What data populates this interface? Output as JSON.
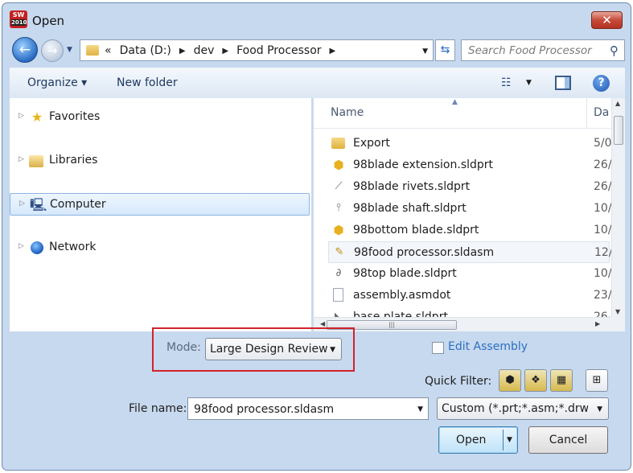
{
  "window": {
    "title": "Open",
    "app_icon_text": "SW",
    "app_icon_year": "2010",
    "close_glyph": "✕"
  },
  "nav": {
    "back_glyph": "←",
    "forward_glyph": "→",
    "breadcrumb_prefix": "«",
    "breadcrumbs": [
      "Data (D:)",
      "dev",
      "Food Processor"
    ],
    "search_placeholder": "Search Food Processor"
  },
  "toolbar": {
    "organize_label": "Organize ▾",
    "new_folder_label": "New folder",
    "help_glyph": "?"
  },
  "nav_pane": {
    "items": [
      {
        "label": "Favorites",
        "icon": "star-icon"
      },
      {
        "label": "Libraries",
        "icon": "libraries-icon"
      },
      {
        "label": "Computer",
        "icon": "computer-icon",
        "selected": true
      },
      {
        "label": "Network",
        "icon": "network-icon"
      }
    ]
  },
  "file_list": {
    "columns": {
      "name": "Name",
      "date": "Da"
    },
    "files": [
      {
        "name": "Export",
        "date": "5/0",
        "icon": "folder-icon"
      },
      {
        "name": "98blade extension.sldprt",
        "date": "26/",
        "icon": "part-icon"
      },
      {
        "name": "98blade rivets.sldprt",
        "date": "26/",
        "icon": "part-icon"
      },
      {
        "name": "98blade shaft.sldprt",
        "date": "10/",
        "icon": "part-icon"
      },
      {
        "name": "98bottom blade.sldprt",
        "date": "10/",
        "icon": "part-icon"
      },
      {
        "name": "98food processor.sldasm",
        "date": "12/",
        "icon": "assembly-icon",
        "selected": true
      },
      {
        "name": "98top blade.sldprt",
        "date": "10/",
        "icon": "part-icon"
      },
      {
        "name": "assembly.asmdot",
        "date": "23/",
        "icon": "document-icon"
      },
      {
        "name": "base plate.sldprt",
        "date": "26/",
        "icon": "part-icon"
      }
    ]
  },
  "bottom": {
    "mode_label": "Mode:",
    "mode_value": "Large Design Review",
    "edit_assembly_label": "Edit Assembly",
    "quick_filter_label": "Quick Filter:",
    "file_name_label": "File name:",
    "file_name_value": "98food processor.sldasm",
    "filter_value": "Custom (*.prt;*.asm;*.drw;*.sl",
    "open_label": "Open",
    "cancel_label": "Cancel"
  },
  "colors": {
    "window_bg": "#c7d9ee",
    "highlight_box": "#d2232a",
    "link": "#2d6fc1"
  }
}
